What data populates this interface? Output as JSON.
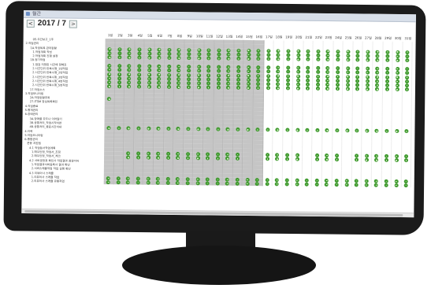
{
  "window": {
    "title": "월간"
  },
  "header": {
    "year_month": "2017 / 7",
    "prev_label": "<",
    "next_label": ">"
  },
  "days": [
    "1일",
    "2일",
    "3일",
    "4일",
    "5일",
    "6일",
    "7일",
    "8일",
    "9일",
    "10일",
    "11일",
    "12일",
    "13일",
    "14일",
    "15일",
    "16일",
    "17일",
    "18일",
    "19일",
    "20일",
    "21일",
    "22일",
    "23일",
    "24일",
    "25일",
    "26일",
    "27일",
    "28일",
    "29일",
    "30일",
    "31일"
  ],
  "colors": {
    "weekend_band": "#c5c5c5",
    "check_mark": "#3f9a2e",
    "bezel": "#1b1b1b"
  },
  "gray_days": {
    "from": 1,
    "to": 16
  },
  "rows": [
    {
      "label": "05.주간보고_1주",
      "indent": 4,
      "marks": "none"
    },
    {
      "label": "2.작업관리",
      "indent": 1,
      "marks": "none"
    },
    {
      "label": "1A.작업목록 관리현황",
      "indent": 3,
      "marks": "all"
    },
    {
      "label": "1.작업계획 작성",
      "indent": 4,
      "marks": "all"
    },
    {
      "label": "2.작업계획 진행 설정",
      "indent": 4,
      "marks": "all"
    },
    {
      "label": "1B.정기작업",
      "indent": 3,
      "marks": "none"
    },
    {
      "label": "1.점검 지정된 시간에 정해진",
      "indent": 4,
      "marks": "all"
    },
    {
      "label": "2.시간단위 반복수행_1번작업",
      "indent": 4,
      "marks": "all"
    },
    {
      "label": "2.시간단위 반복수행_2번작업",
      "indent": 4,
      "marks": "all"
    },
    {
      "label": "2.시간단위 반복수행_3번작업",
      "indent": 4,
      "marks": "all"
    },
    {
      "label": "2.시간단위 반복수행_4번작업",
      "indent": 4,
      "marks": "all"
    },
    {
      "label": "2.시간단위 반복수행_5번작업",
      "indent": 4,
      "marks": "all"
    },
    {
      "label": "17.작업소스",
      "indent": 3,
      "marks": "none"
    },
    {
      "label": "3.작업모니터링",
      "indent": 1,
      "marks": "none"
    },
    {
      "label": "2A.작업현황조회",
      "indent": 3,
      "marks": "first"
    },
    {
      "label": "27.ITSM 장님목록확인",
      "indent": 3,
      "marks": "none"
    },
    {
      "label": "4.작업종료",
      "indent": 1,
      "marks": "none"
    },
    {
      "label": "5.통계관리",
      "indent": 1,
      "marks": "none"
    },
    {
      "label": "6.장애관리",
      "indent": 1,
      "marks": "none"
    },
    {
      "label": "3A.장애를 모두나 이어달기",
      "indent": 3,
      "marks": "none"
    },
    {
      "label": "3B.공통처리_작업시작이면",
      "indent": 3,
      "marks": "none"
    },
    {
      "label": "4B.공통처리_종료시간이내",
      "indent": 3,
      "marks": "all"
    },
    {
      "label": "4.이력",
      "indent": 1,
      "marks": "none"
    },
    {
      "label": "5.작업모니터링",
      "indent": 1,
      "marks": "none"
    },
    {
      "label": "6.통합관리",
      "indent": 1,
      "marks": "none"
    },
    {
      "label": "운용 지원팀",
      "indent": 2,
      "marks": "none"
    },
    {
      "label": "4.1 작업등서작업계획",
      "indent": 3,
      "marks": "none"
    },
    {
      "label": "1.매우안정_작업서_조정",
      "indent": 4,
      "marks": "pattern"
    },
    {
      "label": "2.매우안정_작업서_체크",
      "indent": 4,
      "marks": "pattern"
    },
    {
      "label": "4.2 서버공정표 확인사 작업결과 점검이어",
      "indent": 3,
      "marks": "none"
    },
    {
      "label": "1.작업결과서버등록사 결과 확인",
      "indent": 4,
      "marks": "none"
    },
    {
      "label": "2.서버스케쥴작업 작업 실행 확인",
      "indent": 4,
      "marks": "none"
    },
    {
      "label": "4.3 리뷰어사 스케쥴",
      "indent": 3,
      "marks": "none"
    },
    {
      "label": "1.리뷰어사 스케쥴 작업",
      "indent": 4,
      "marks": "all"
    },
    {
      "label": "2.리뷰어사 스케쥴 유통작업",
      "indent": 4,
      "marks": "all"
    }
  ],
  "pattern_days": [
    3,
    4,
    5,
    6,
    7,
    8,
    9,
    10,
    11,
    12,
    13,
    14,
    17,
    18,
    19,
    20,
    22,
    23,
    24,
    26,
    27,
    28,
    29,
    30,
    31
  ]
}
